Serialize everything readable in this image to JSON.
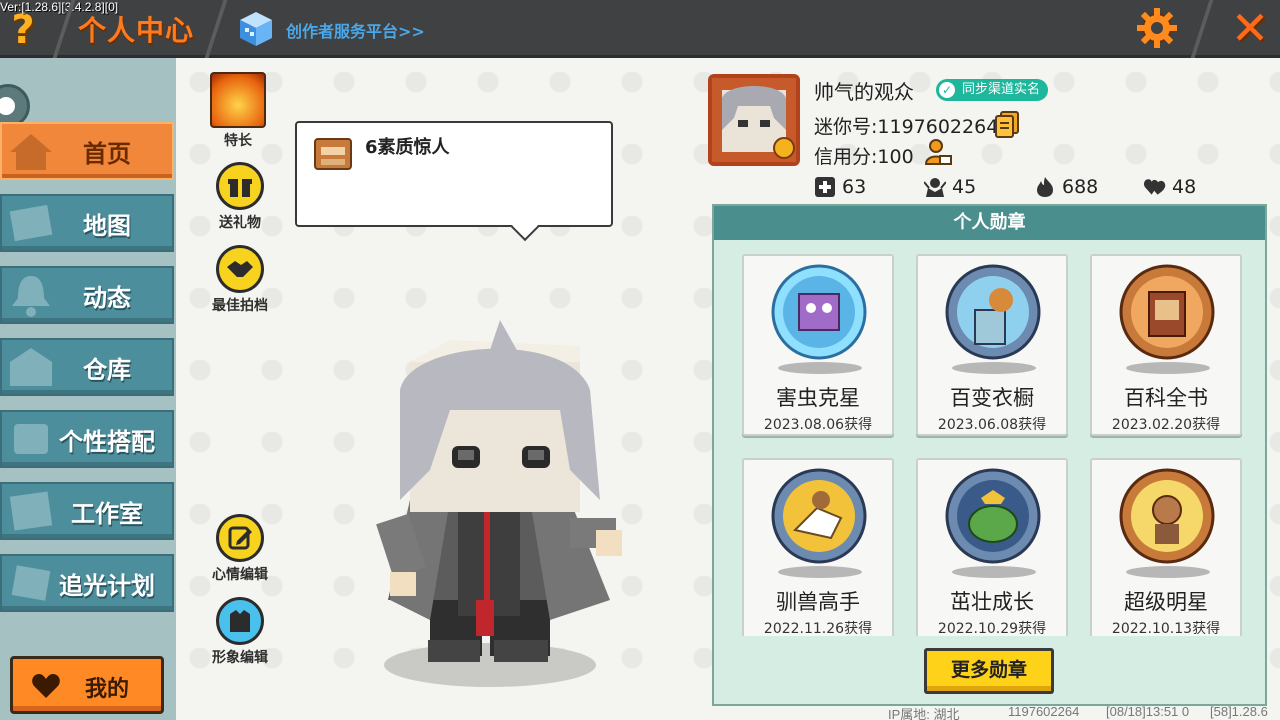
{
  "app": {
    "version": "Ver:[1.28.6][3.4.2.8][0]",
    "title": "个人中心",
    "creator_link": "创作者服务平台>>",
    "help_glyph": "?",
    "close_glyph": "✕"
  },
  "sidebar": {
    "items": [
      {
        "label": "首页",
        "icon": "home-icon",
        "active": true
      },
      {
        "label": "地图",
        "icon": "map-icon",
        "active": false
      },
      {
        "label": "动态",
        "icon": "bell-icon",
        "active": false
      },
      {
        "label": "仓库",
        "icon": "warehouse-icon",
        "active": false
      },
      {
        "label": "个性搭配",
        "icon": "outfit-icon",
        "active": false
      },
      {
        "label": "工作室",
        "icon": "studio-icon",
        "active": false
      },
      {
        "label": "追光计划",
        "icon": "spotlight-icon",
        "active": false
      }
    ],
    "my_button": "我的"
  },
  "actions": {
    "talent": "特长",
    "gift": "送礼物",
    "best_partner": "最佳拍档",
    "mood_edit": "心情编辑",
    "avatar_edit": "形象编辑"
  },
  "bubble": {
    "text": "6素质惊人"
  },
  "profile": {
    "nickname": "帅气的观众",
    "realname_badge": "同步渠道实名",
    "mini_id": "迷你号:1197602264",
    "credit": "信用分:100",
    "stats": {
      "posts": "63",
      "fans": "45",
      "popularity": "688",
      "likes": "48"
    }
  },
  "medals": {
    "header": "个人勋章",
    "items": [
      {
        "name": "害虫克星",
        "date": "2023.08.06获得",
        "theme": "#6cc2ea"
      },
      {
        "name": "百变衣橱",
        "date": "2023.06.08获得",
        "theme": "#5a6f8c"
      },
      {
        "name": "百科全书",
        "date": "2023.02.20获得",
        "theme": "#b8642a"
      },
      {
        "name": "驯兽高手",
        "date": "2022.11.26获得",
        "theme": "#5a6f8c"
      },
      {
        "name": "茁壮成长",
        "date": "2022.10.29获得",
        "theme": "#5a6f8c"
      },
      {
        "name": "超级明星",
        "date": "2022.10.13获得",
        "theme": "#b8642a"
      }
    ],
    "more_button": "更多勋章"
  },
  "footer": {
    "ip": "IP属地: 湖北",
    "uid": "1197602264",
    "time": "[08/18]13:51 0",
    "build": "[58]1.28.6"
  }
}
